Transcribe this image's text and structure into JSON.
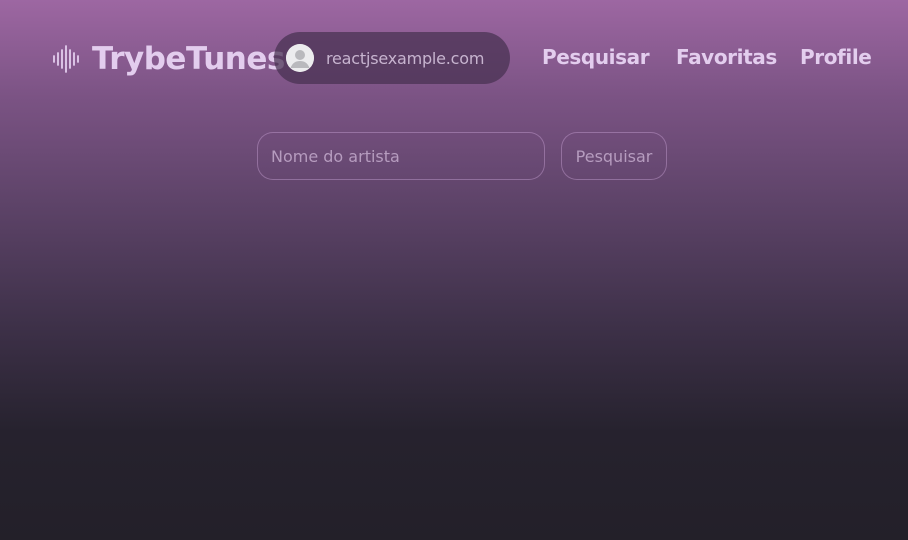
{
  "header": {
    "logo_icon": "soundwave-icon",
    "logo_text": "TrybeTunes",
    "user": {
      "avatar_icon": "user-avatar-icon",
      "email": "reactjsexample.com"
    },
    "nav": [
      {
        "label": "Pesquisar"
      },
      {
        "label": "Favoritas"
      },
      {
        "label": "Profile"
      }
    ]
  },
  "search": {
    "placeholder": "Nome do artista",
    "value": "",
    "button_label": "Pesquisar"
  },
  "colors": {
    "gradient_top": "#9d67a2",
    "gradient_bottom": "#232029",
    "text_primary": "#e3cdee",
    "text_muted": "#b69cbf"
  }
}
